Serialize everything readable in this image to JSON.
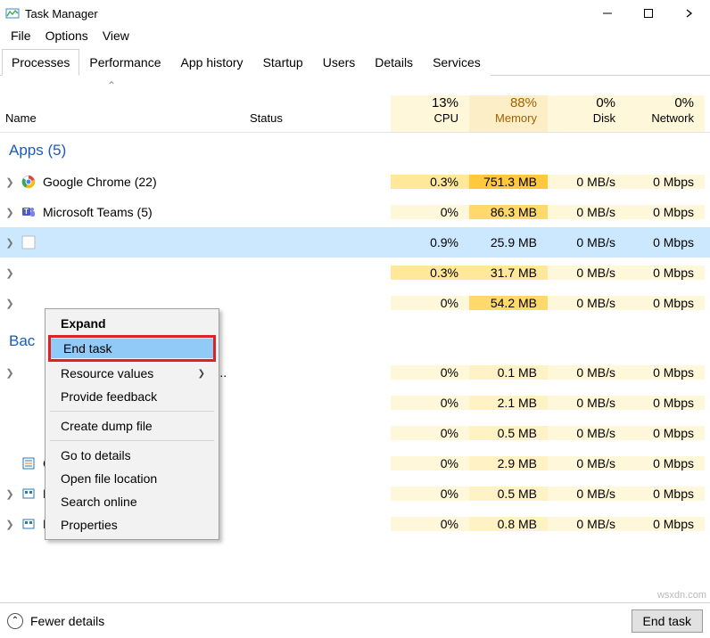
{
  "window": {
    "title": "Task Manager"
  },
  "menu": {
    "file": "File",
    "options": "Options",
    "view": "View"
  },
  "tabs": [
    "Processes",
    "Performance",
    "App history",
    "Startup",
    "Users",
    "Details",
    "Services"
  ],
  "columns": {
    "name": "Name",
    "status": "Status",
    "cpu_pct": "13%",
    "cpu_lbl": "CPU",
    "mem_pct": "88%",
    "mem_lbl": "Memory",
    "disk_pct": "0%",
    "disk_lbl": "Disk",
    "net_pct": "0%",
    "net_lbl": "Network"
  },
  "groups": {
    "apps": "Apps (5)",
    "background": "Bac"
  },
  "rows": [
    {
      "name": "Google Chrome (22)",
      "cpu": "0.3%",
      "mem": "751.3 MB",
      "disk": "0 MB/s",
      "net": "0 Mbps",
      "icon": "chrome",
      "exp": true
    },
    {
      "name": "Microsoft Teams (5)",
      "cpu": "0%",
      "mem": "86.3 MB",
      "disk": "0 MB/s",
      "net": "0 Mbps",
      "icon": "teams",
      "exp": true
    },
    {
      "name": "",
      "cpu": "0.9%",
      "mem": "25.9 MB",
      "disk": "0 MB/s",
      "net": "0 Mbps",
      "icon": "blank",
      "exp": true,
      "sel": true
    },
    {
      "name": "",
      "cpu": "0.3%",
      "mem": "31.7 MB",
      "disk": "0 MB/s",
      "net": "0 Mbps",
      "icon": "",
      "exp": true
    },
    {
      "name": "",
      "cpu": "0%",
      "mem": "54.2 MB",
      "disk": "0 MB/s",
      "net": "0 Mbps",
      "icon": "",
      "exp": true
    }
  ],
  "bg_rows": [
    {
      "name": "                                              an...",
      "cpu": "0%",
      "mem": "0.1 MB",
      "disk": "0 MB/s",
      "net": "0 Mbps",
      "exp": true
    },
    {
      "name": "",
      "cpu": "0%",
      "mem": "2.1 MB",
      "disk": "0 MB/s",
      "net": "0 Mbps",
      "exp": false
    },
    {
      "name": "",
      "cpu": "0%",
      "mem": "0.5 MB",
      "disk": "0 MB/s",
      "net": "0 Mbps",
      "exp": false
    },
    {
      "name": "CTF Loader",
      "cpu": "0%",
      "mem": "2.9 MB",
      "disk": "0 MB/s",
      "net": "0 Mbps",
      "icon": "ctf",
      "exp": false
    },
    {
      "name": "DAX API",
      "cpu": "0%",
      "mem": "0.5 MB",
      "disk": "0 MB/s",
      "net": "0 Mbps",
      "icon": "dax",
      "exp": true
    },
    {
      "name": "DAX API",
      "cpu": "0%",
      "mem": "0.8 MB",
      "disk": "0 MB/s",
      "net": "0 Mbps",
      "icon": "dax",
      "exp": true
    }
  ],
  "ctx": {
    "expand": "Expand",
    "end": "End task",
    "res": "Resource values",
    "fb": "Provide feedback",
    "dump": "Create dump file",
    "details": "Go to details",
    "open": "Open file location",
    "search": "Search online",
    "props": "Properties",
    "arrow": "❯"
  },
  "footer": {
    "fewer": "Fewer details",
    "end": "End task"
  },
  "watermark": "wsxdn.com"
}
